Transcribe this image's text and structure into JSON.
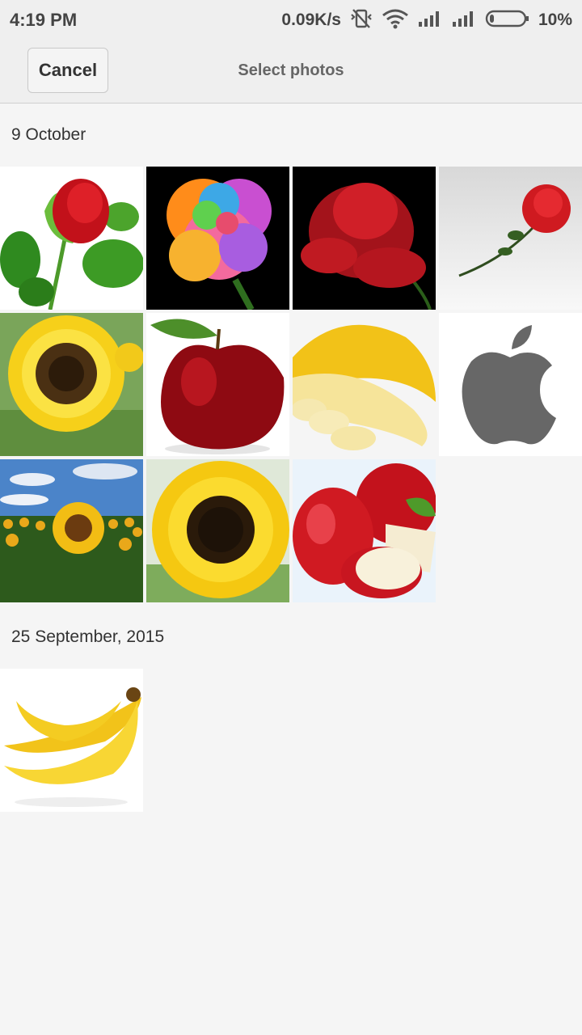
{
  "status_bar": {
    "time": "4:19 PM",
    "net_speed": "0.09K/s",
    "battery_percent": "10%",
    "icons": [
      "vibrate-off-icon",
      "wifi-icon",
      "signal-icon",
      "signal-icon",
      "battery-icon"
    ]
  },
  "app_bar": {
    "cancel_label": "Cancel",
    "title": "Select photos"
  },
  "sections": [
    {
      "date": "9 October",
      "photos": [
        "red-rose-leaves",
        "rainbow-rose",
        "red-rose-black-bg",
        "single-rose-stem",
        "sunflower",
        "red-apple",
        "bananas-sliced",
        "apple-logo",
        "sunflower-field",
        "sunflower-closeup",
        "red-apples-cut"
      ]
    },
    {
      "date": "25 September, 2015",
      "photos": [
        "banana-bunch"
      ]
    }
  ]
}
